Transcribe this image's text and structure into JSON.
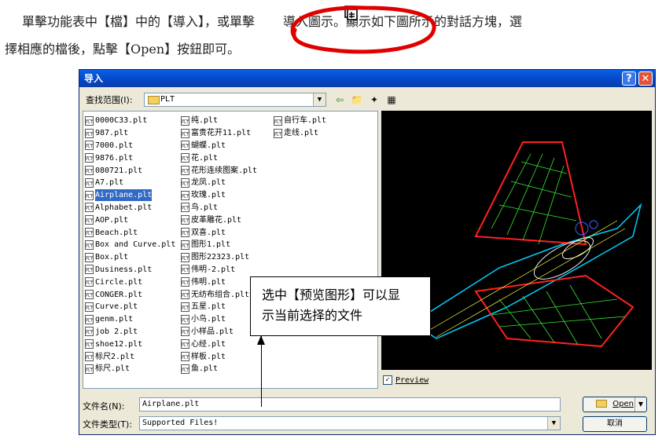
{
  "doc": {
    "line1_a": "單擊功能表中【檔】中的【導入】",
    "line1_b": "，或單擊",
    "line1_c": "導入圖示。顯示如下圖所示的對話方塊，選",
    "line2": "擇相應的檔後，點擊【Open】按鈕即可。"
  },
  "dialog": {
    "title": "导入",
    "help_label": "?",
    "close_label": "✕",
    "lookin_label": "查找范围(I):",
    "lookin_value": "PLT",
    "toolbar": [
      "⇦",
      "📁",
      "✦",
      "▦"
    ],
    "files_col1": [
      "0000C33.plt",
      "987.plt",
      "7000.plt",
      "9876.plt",
      "080721.plt",
      "A7.plt",
      "Airplane.plt",
      "Alphabet.plt",
      "AOP.plt",
      "Beach.plt",
      "Box and Curve.plt",
      "Box.plt",
      "Dusiness.plt",
      "Circle.plt",
      "CONGER.plt",
      "Curve.plt",
      "genm.plt",
      "job 2.plt",
      "shoe12.plt",
      "标尺2.plt",
      "标尺.plt"
    ],
    "files_col2": [
      "纯.plt",
      "富贵花开11.plt",
      "蝴蝶.plt",
      "花.plt",
      "花形连续图案.plt",
      "龙凤.plt",
      "玫瑰.plt",
      "鸟.plt",
      "皮革雕花.plt",
      "双喜.plt",
      "图形1.plt",
      "图形22323.plt",
      "伟明-2.plt",
      "伟明.plt",
      "无纺布组合.plt",
      "五星.plt",
      "小鸟.plt",
      "小样品.plt",
      "心经.plt",
      "样板.plt",
      "鱼.plt"
    ],
    "files_col3": [
      "自行车.plt",
      "走线.plt"
    ],
    "selected_file": "Airplane.plt",
    "icon_text": "PLT",
    "preview_label": "Preview",
    "preview_checked": "✓",
    "filename_label": "文件名(N):",
    "filename_value": "Airplane.plt",
    "filetype_label": "文件类型(T):",
    "filetype_value": "Supported Files!",
    "open_label": "Open",
    "cancel_label": "取消"
  },
  "callout": {
    "line1": "选中【预览图形】可以显",
    "line2": "示当前选择的文件"
  },
  "colors": {
    "accent": "#316ac5",
    "title": "#0a5fe6",
    "highlight": "#e00000"
  }
}
